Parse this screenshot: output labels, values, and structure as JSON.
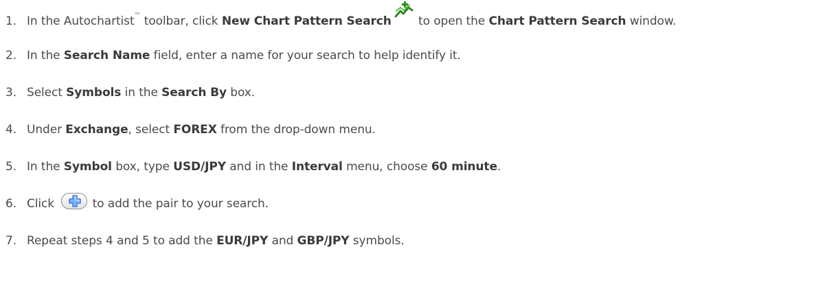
{
  "steps": [
    {
      "number": "1.",
      "parts": [
        {
          "text": "In the Autochartist",
          "bold": false
        },
        {
          "text": "™",
          "tm": true
        },
        {
          "text": " toolbar, click ",
          "bold": false
        },
        {
          "text": "New Chart Pattern Search",
          "bold": true
        },
        {
          "icon": "chart-pattern-search-icon"
        },
        {
          "text": " to open the ",
          "bold": false
        },
        {
          "text": "Chart Pattern Search",
          "bold": true
        },
        {
          "text": " window.",
          "bold": false
        }
      ]
    },
    {
      "number": "2.",
      "parts": [
        {
          "text": "In the ",
          "bold": false
        },
        {
          "text": "Search Name",
          "bold": true
        },
        {
          "text": " field, enter a name for your search to help identify it.",
          "bold": false
        }
      ]
    },
    {
      "number": "3.",
      "parts": [
        {
          "text": "Select ",
          "bold": false
        },
        {
          "text": "Symbols",
          "bold": true
        },
        {
          "text": " in the ",
          "bold": false
        },
        {
          "text": "Search By",
          "bold": true
        },
        {
          "text": " box.",
          "bold": false
        }
      ]
    },
    {
      "number": "4.",
      "parts": [
        {
          "text": "Under ",
          "bold": false
        },
        {
          "text": "Exchange",
          "bold": true
        },
        {
          "text": ", select ",
          "bold": false
        },
        {
          "text": "FOREX",
          "bold": true
        },
        {
          "text": " from the drop-down menu.",
          "bold": false
        }
      ]
    },
    {
      "number": "5.",
      "parts": [
        {
          "text": "In the ",
          "bold": false
        },
        {
          "text": "Symbol",
          "bold": true
        },
        {
          "text": " box, type ",
          "bold": false
        },
        {
          "text": "USD/JPY",
          "bold": true
        },
        {
          "text": " and in the ",
          "bold": false
        },
        {
          "text": "Interval",
          "bold": true
        },
        {
          "text": " menu, choose ",
          "bold": false
        },
        {
          "text": "60 minute",
          "bold": true
        },
        {
          "text": ".",
          "bold": false
        }
      ]
    },
    {
      "number": "6.",
      "parts": [
        {
          "text": "Click ",
          "bold": false
        },
        {
          "icon": "add-button-icon"
        },
        {
          "text": " to add the pair to your search.",
          "bold": false
        }
      ]
    },
    {
      "number": "7.",
      "parts": [
        {
          "text": "Repeat steps 4 and 5 to add the ",
          "bold": false
        },
        {
          "text": "EUR/JPY",
          "bold": true
        },
        {
          "text": " and ",
          "bold": false
        },
        {
          "text": "GBP/JPY",
          "bold": true
        },
        {
          "text": " symbols.",
          "bold": false
        }
      ]
    }
  ],
  "colors": {
    "text": "#4a4a4a",
    "bold_text": "#3a3a3a",
    "icon_green": "#2e8b1e",
    "add_button_blue": "#3a7bd5"
  }
}
